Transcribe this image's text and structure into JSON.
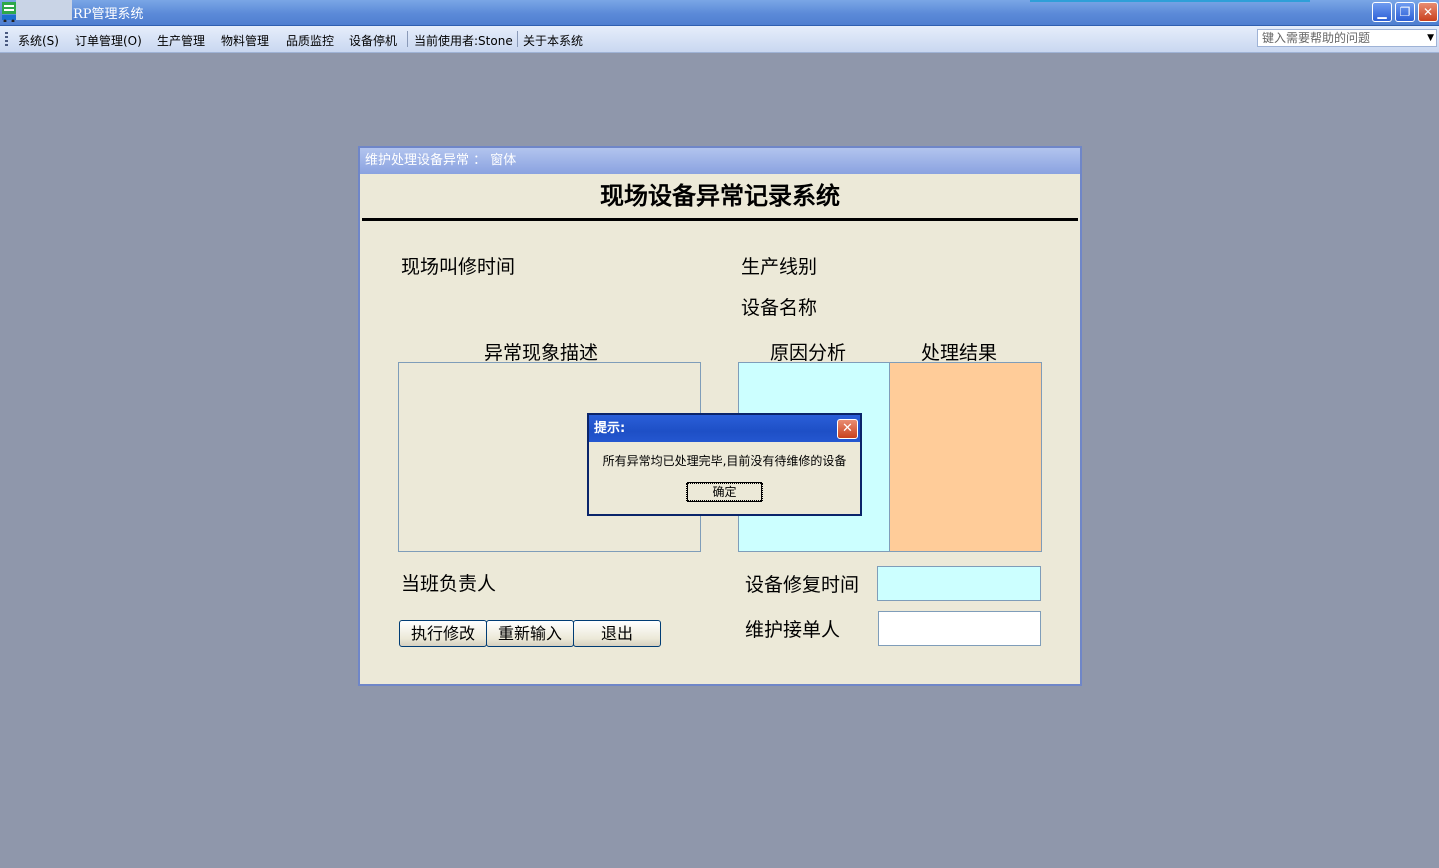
{
  "app": {
    "title": "RP管理系统",
    "controls": {
      "minimize": "▁",
      "restore": "❐",
      "close": "✕"
    }
  },
  "menu": {
    "items": [
      "系统(S)",
      "订单管理(O)",
      "生产管理",
      "物料管理",
      "品质监控",
      "设备停机"
    ],
    "current_user": "当前使用者:Stone",
    "about": "关于本系统",
    "help_placeholder": "键入需要帮助的问题"
  },
  "form": {
    "window_title": "维护处理设备异常 ： 窗体",
    "heading": "现场设备异常记录系统",
    "labels": {
      "call_time": "现场叫修时间",
      "line": "生产线别",
      "equipment": "设备名称",
      "description": "异常现象描述",
      "cause": "原因分析",
      "result": "处理结果",
      "shift_lead": "当班负责人",
      "repair_time": "设备修复时间",
      "receiver": "维护接单人"
    },
    "buttons": {
      "modify": "执行修改",
      "reset": "重新输入",
      "exit": "退出"
    },
    "colors": {
      "cause_bg": "#ccffff",
      "result_bg": "#ffcc99",
      "repair_time_bg": "#ccffff"
    }
  },
  "dialog": {
    "title": "提示:",
    "message": "所有异常均已处理完毕,目前没有待维修的设备",
    "ok": "确定",
    "close": "✕"
  }
}
